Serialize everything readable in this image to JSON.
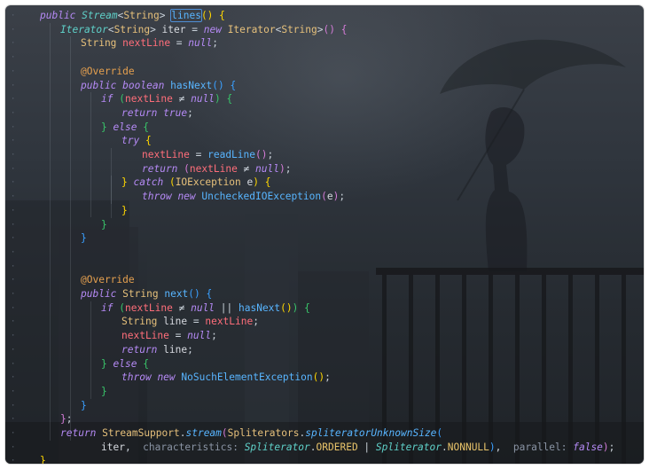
{
  "editor": {
    "language": "java",
    "lines": [
      [
        [
          "kw it",
          "public"
        ],
        [
          "pu",
          " "
        ],
        [
          "tyt",
          "Stream"
        ],
        [
          "pu",
          "<"
        ],
        [
          "ty",
          "String"
        ],
        [
          "pu",
          "> "
        ],
        [
          "fn sel",
          "lines"
        ],
        [
          "br1",
          "()"
        ],
        [
          "pu",
          " "
        ],
        [
          "br1",
          "{"
        ]
      ],
      [
        [
          "tyt",
          "Iterator"
        ],
        [
          "pu",
          "<"
        ],
        [
          "ty",
          "String"
        ],
        [
          "pu",
          "> "
        ],
        [
          "var",
          "iter"
        ],
        [
          "pu",
          " = "
        ],
        [
          "kw it",
          "new"
        ],
        [
          "pu",
          " "
        ],
        [
          "ty",
          "Iterator"
        ],
        [
          "pu",
          "<"
        ],
        [
          "ty",
          "String"
        ],
        [
          "pu",
          ">"
        ],
        [
          "br2",
          "()"
        ],
        [
          "pu",
          " "
        ],
        [
          "br2",
          "{"
        ]
      ],
      [
        [
          "ty",
          "String"
        ],
        [
          "pu",
          " "
        ],
        [
          "fld",
          "nextLine"
        ],
        [
          "pu",
          " = "
        ],
        [
          "kw it",
          "null"
        ],
        [
          "pu",
          ";"
        ]
      ],
      [],
      [
        [
          "an",
          "@Override"
        ]
      ],
      [
        [
          "kw it",
          "public"
        ],
        [
          "pu",
          " "
        ],
        [
          "kw it",
          "boolean"
        ],
        [
          "pu",
          " "
        ],
        [
          "fn",
          "hasNext"
        ],
        [
          "br3",
          "()"
        ],
        [
          "pu",
          " "
        ],
        [
          "br3",
          "{"
        ]
      ],
      [
        [
          "kw it",
          "if"
        ],
        [
          "pu",
          " "
        ],
        [
          "br4",
          "("
        ],
        [
          "fld",
          "nextLine"
        ],
        [
          "pu",
          " ≠ "
        ],
        [
          "kw it",
          "null"
        ],
        [
          "br4",
          ")"
        ],
        [
          "pu",
          " "
        ],
        [
          "br4",
          "{"
        ]
      ],
      [
        [
          "kw it",
          "return"
        ],
        [
          "pu",
          " "
        ],
        [
          "kw it",
          "true"
        ],
        [
          "pu",
          ";"
        ]
      ],
      [
        [
          "br4",
          "}"
        ],
        [
          "pu",
          " "
        ],
        [
          "kw it",
          "else"
        ],
        [
          "pu",
          " "
        ],
        [
          "br4",
          "{"
        ]
      ],
      [
        [
          "kw it",
          "try"
        ],
        [
          "pu",
          " "
        ],
        [
          "br1",
          "{"
        ]
      ],
      [
        [
          "fld",
          "nextLine"
        ],
        [
          "pu",
          " = "
        ],
        [
          "fn",
          "readLine"
        ],
        [
          "br2",
          "()"
        ],
        [
          "pu",
          ";"
        ]
      ],
      [
        [
          "kw it",
          "return"
        ],
        [
          "pu",
          " "
        ],
        [
          "br2",
          "("
        ],
        [
          "fld",
          "nextLine"
        ],
        [
          "pu",
          " ≠ "
        ],
        [
          "kw it",
          "null"
        ],
        [
          "br2",
          ")"
        ],
        [
          "pu",
          ";"
        ]
      ],
      [
        [
          "br1",
          "}"
        ],
        [
          "pu",
          " "
        ],
        [
          "kw it",
          "catch"
        ],
        [
          "pu",
          " "
        ],
        [
          "br1",
          "("
        ],
        [
          "ty",
          "IOException"
        ],
        [
          "pu",
          " "
        ],
        [
          "var",
          "e"
        ],
        [
          "br1",
          ")"
        ],
        [
          "pu",
          " "
        ],
        [
          "br1",
          "{"
        ]
      ],
      [
        [
          "kw it",
          "throw"
        ],
        [
          "pu",
          " "
        ],
        [
          "kw it",
          "new"
        ],
        [
          "pu",
          " "
        ],
        [
          "fn",
          "UncheckedIOException"
        ],
        [
          "br2",
          "("
        ],
        [
          "var",
          "e"
        ],
        [
          "br2",
          ")"
        ],
        [
          "pu",
          ";"
        ]
      ],
      [
        [
          "br1",
          "}"
        ]
      ],
      [
        [
          "br4",
          "}"
        ]
      ],
      [
        [
          "br3",
          "}"
        ]
      ],
      [],
      [],
      [
        [
          "an",
          "@Override"
        ]
      ],
      [
        [
          "kw it",
          "public"
        ],
        [
          "pu",
          " "
        ],
        [
          "ty",
          "String"
        ],
        [
          "pu",
          " "
        ],
        [
          "fn",
          "next"
        ],
        [
          "br3",
          "()"
        ],
        [
          "pu",
          " "
        ],
        [
          "br3",
          "{"
        ]
      ],
      [
        [
          "kw it",
          "if"
        ],
        [
          "pu",
          " "
        ],
        [
          "br4",
          "("
        ],
        [
          "fld",
          "nextLine"
        ],
        [
          "pu",
          " ≠ "
        ],
        [
          "kw it",
          "null"
        ],
        [
          "pu",
          " || "
        ],
        [
          "fn",
          "hasNext"
        ],
        [
          "br1",
          "()"
        ],
        [
          "br4",
          ")"
        ],
        [
          "pu",
          " "
        ],
        [
          "br4",
          "{"
        ]
      ],
      [
        [
          "ty",
          "String"
        ],
        [
          "pu",
          " "
        ],
        [
          "var",
          "line"
        ],
        [
          "pu",
          " = "
        ],
        [
          "fld",
          "nextLine"
        ],
        [
          "pu",
          ";"
        ]
      ],
      [
        [
          "fld",
          "nextLine"
        ],
        [
          "pu",
          " = "
        ],
        [
          "kw it",
          "null"
        ],
        [
          "pu",
          ";"
        ]
      ],
      [
        [
          "kw it",
          "return"
        ],
        [
          "pu",
          " "
        ],
        [
          "var",
          "line"
        ],
        [
          "pu",
          ";"
        ]
      ],
      [
        [
          "br4",
          "}"
        ],
        [
          "pu",
          " "
        ],
        [
          "kw it",
          "else"
        ],
        [
          "pu",
          " "
        ],
        [
          "br4",
          "{"
        ]
      ],
      [
        [
          "kw it",
          "throw"
        ],
        [
          "pu",
          " "
        ],
        [
          "kw it",
          "new"
        ],
        [
          "pu",
          " "
        ],
        [
          "fn",
          "NoSuchElementException"
        ],
        [
          "br1",
          "()"
        ],
        [
          "pu",
          ";"
        ]
      ],
      [
        [
          "br4",
          "}"
        ]
      ],
      [
        [
          "br3",
          "}"
        ]
      ],
      [
        [
          "br2",
          "}"
        ],
        [
          "pu",
          ";"
        ]
      ],
      [
        [
          "kw it",
          "return"
        ],
        [
          "pu",
          " "
        ],
        [
          "ty",
          "StreamSupport"
        ],
        [
          "pu",
          "."
        ],
        [
          "fni",
          "stream"
        ],
        [
          "br2",
          "("
        ],
        [
          "ty",
          "Spliterators"
        ],
        [
          "pu",
          "."
        ],
        [
          "fni",
          "spliteratorUnknownSize"
        ],
        [
          "br3",
          "("
        ]
      ],
      [
        [
          "var",
          "iter"
        ],
        [
          "pu",
          ",  "
        ],
        [
          "ph",
          "characteristics: "
        ],
        [
          "tyt",
          "Spliterator"
        ],
        [
          "pu",
          "."
        ],
        [
          "cn",
          "ORDERED"
        ],
        [
          "pu",
          " | "
        ],
        [
          "tyt",
          "Spliterator"
        ],
        [
          "pu",
          "."
        ],
        [
          "cn",
          "NONNULL"
        ],
        [
          "br3",
          ")"
        ],
        [
          "pu",
          ",  "
        ],
        [
          "ph",
          "parallel: "
        ],
        [
          "kw it",
          "false"
        ],
        [
          "br2",
          ")"
        ],
        [
          "pu",
          ";"
        ]
      ],
      [
        [
          "br1",
          "}"
        ]
      ],
      [
        [
          "br2",
          "}"
        ]
      ]
    ]
  },
  "colors": {
    "keyword": "#b58af5",
    "type": "#e6c07b",
    "field": "#ff6e7a",
    "function": "#58b5ff",
    "annotation": "#e5a04f",
    "constant": "#e9c46a",
    "param_hint": "#8a94a4"
  },
  "icons": {
    "gutter_marker": "fold-marker-icon"
  }
}
